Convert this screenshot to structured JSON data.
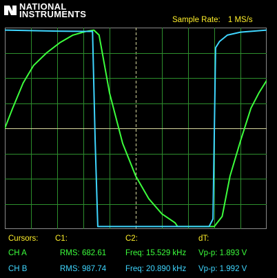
{
  "header": {
    "brand_line1": "NATIONAL",
    "brand_line2": "INSTRUMENTS",
    "sample_rate_label": "Sample Rate:",
    "sample_rate_value": "1 MS/s",
    "logo_icon": "ni-eagle-icon"
  },
  "colors": {
    "background": "#000000",
    "grid": "#2d8f2d",
    "grid_center": "#d8d8a0",
    "channel_a": "#3cff3c",
    "channel_b": "#3fd6ff",
    "label": "#ffef2a",
    "frame": "#8a8a8a"
  },
  "readout": {
    "header": {
      "cursors": "Cursors:",
      "c1": "C1:",
      "c2": "C2:",
      "dt": "dT:"
    },
    "channels": [
      {
        "name": "CH A",
        "rms": "RMS: 682.61",
        "freq": "Freq: 15.529 kHz",
        "vpp": "Vp-p: 1.893 V"
      },
      {
        "name": "CH B",
        "rms": "RMS: 987.74",
        "freq": "Freq: 20.890 kHz",
        "vpp": "Vp-p: 1.992 V"
      }
    ]
  },
  "chart_data": {
    "type": "line",
    "grid": true,
    "title": "",
    "xlabel": "",
    "ylabel": "",
    "divisions": {
      "x": 10,
      "y": 8
    },
    "xlim": [
      0,
      10
    ],
    "ylim": [
      -4,
      4
    ],
    "series": [
      {
        "channel": "CH A",
        "color": "#3cff3c",
        "x": [
          0,
          0.3,
          0.7,
          1.1,
          1.6,
          2.1,
          2.6,
          3.1,
          3.4,
          3.6,
          4.0,
          4.5,
          5.0,
          5.5,
          6.0,
          6.5,
          6.6,
          7.0,
          7.5,
          8.0,
          8.3,
          8.6,
          9.0,
          9.4,
          9.7,
          10.0
        ],
        "y": [
          0.0,
          0.8,
          1.8,
          2.5,
          3.0,
          3.4,
          3.7,
          3.85,
          3.9,
          3.7,
          1.4,
          -0.6,
          -1.9,
          -2.8,
          -3.4,
          -3.75,
          -3.9,
          -3.9,
          -3.9,
          -3.9,
          -3.5,
          -1.9,
          -0.5,
          0.8,
          1.4,
          1.9
        ]
      },
      {
        "channel": "CH B",
        "color": "#3fd6ff",
        "x": [
          0,
          1.0,
          2.0,
          3.0,
          3.35,
          3.45,
          3.55,
          4.5,
          6.0,
          7.0,
          7.8,
          7.95,
          8.05,
          8.2,
          8.5,
          9.0,
          9.5,
          10.0
        ],
        "y": [
          3.9,
          3.88,
          3.86,
          3.85,
          3.85,
          -0.5,
          -3.9,
          -3.9,
          -3.9,
          -3.9,
          -3.9,
          -3.6,
          3.2,
          3.45,
          3.7,
          3.82,
          3.86,
          3.9
        ]
      }
    ]
  }
}
